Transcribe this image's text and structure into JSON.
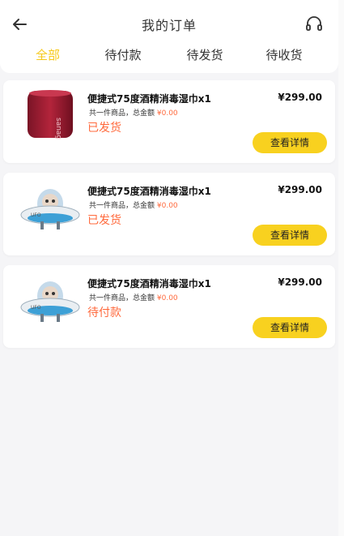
{
  "header": {
    "title": "我的订单",
    "back_icon": "arrow-left-icon",
    "support_icon": "headset-icon"
  },
  "tabs": [
    {
      "label": "全部",
      "active": true
    },
    {
      "label": "待付款",
      "active": false
    },
    {
      "label": "待发货",
      "active": false
    },
    {
      "label": "待收货",
      "active": false
    }
  ],
  "orders": [
    {
      "product": "便捷式75度酒精消毒湿巾x1",
      "price": "¥299.00",
      "summary_prefix": "共一件商品，总金额",
      "amount": "¥0.00",
      "status": "已发货",
      "action": "查看详情",
      "image": "red-speaker"
    },
    {
      "product": "便捷式75度酒精消毒湿巾x1",
      "price": "¥299.00",
      "summary_prefix": "共一件商品，总金额",
      "amount": "¥0.00",
      "status": "已发货",
      "action": "查看详情",
      "image": "ufo-toy"
    },
    {
      "product": "便捷式75度酒精消毒湿巾x1",
      "price": "¥299.00",
      "summary_prefix": "共一件商品，总金额",
      "amount": "¥0.00",
      "status": "待付款",
      "action": "查看详情",
      "image": "ufo-toy"
    }
  ],
  "colors": {
    "accent": "#f6c91b",
    "button": "#f8d11f",
    "status": "#ff6a3d"
  }
}
